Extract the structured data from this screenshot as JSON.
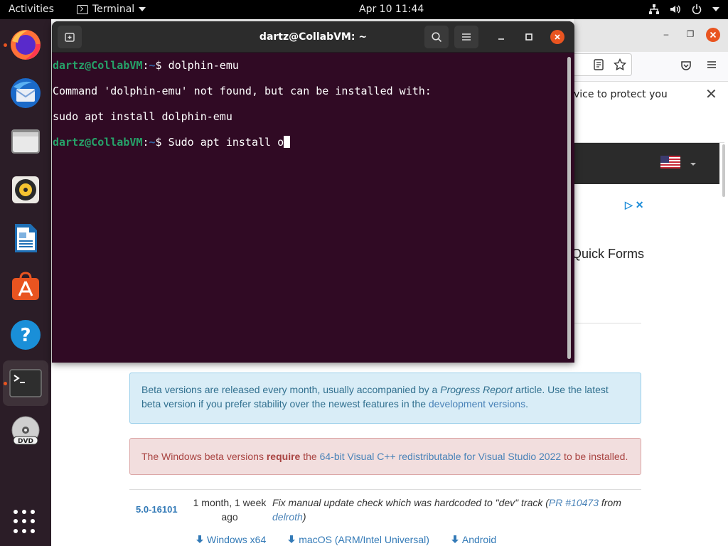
{
  "topbar": {
    "activities": "Activities",
    "app_name": "Terminal",
    "clock": "Apr 10  11:44"
  },
  "dock": {
    "apps": [
      "Firefox",
      "Thunderbird",
      "Files",
      "Rhythmbox",
      "LibreOffice Writer",
      "Ubuntu Software",
      "Help",
      "Terminal",
      "DVD"
    ]
  },
  "terminal": {
    "title": "dartz@CollabVM: ~",
    "prompt_user": "dartz@CollabVM",
    "prompt_path": "~",
    "prompt_symbol": "$ ",
    "command1": "dolphin-emu",
    "output1": "Command 'dolphin-emu' not found, but can be installed with:",
    "output2": "sudo apt install dolphin-emu",
    "command2_input": "Sudo apt install o"
  },
  "browser": {
    "notification_text": "vice to protect you",
    "quick_forms": "Quick Forms",
    "info_alert": {
      "text1": "Beta versions are released every month, usually accompanied by a ",
      "progress_report": "Progress Report",
      "text2": " article. Use the latest beta version if you prefer stability over the newest features in the ",
      "link": "development versions",
      "text3": "."
    },
    "danger_alert": {
      "text1": "The Windows beta versions ",
      "strong": "require",
      "text2": " the ",
      "link": "64-bit Visual C++ redistributable for Visual Studio 2022",
      "text3": " to be installed."
    },
    "release": {
      "version": "5.0-16101",
      "age": "1 month, 1 week ago",
      "desc1": "Fix manual update check which was hardcoded to \"dev\" track (",
      "pr_link": "PR #10473",
      "desc2": " from ",
      "author": "delroth",
      "desc3": ")"
    },
    "downloads": [
      "Windows x64",
      "macOS (ARM/Intel Universal)",
      "Android"
    ]
  },
  "colors": {
    "terminal_bg": "#300a24",
    "prompt_user": "#26a269",
    "prompt_path": "#3465a4",
    "dock_bg": "#2b1d27",
    "accent": "#e95420"
  }
}
